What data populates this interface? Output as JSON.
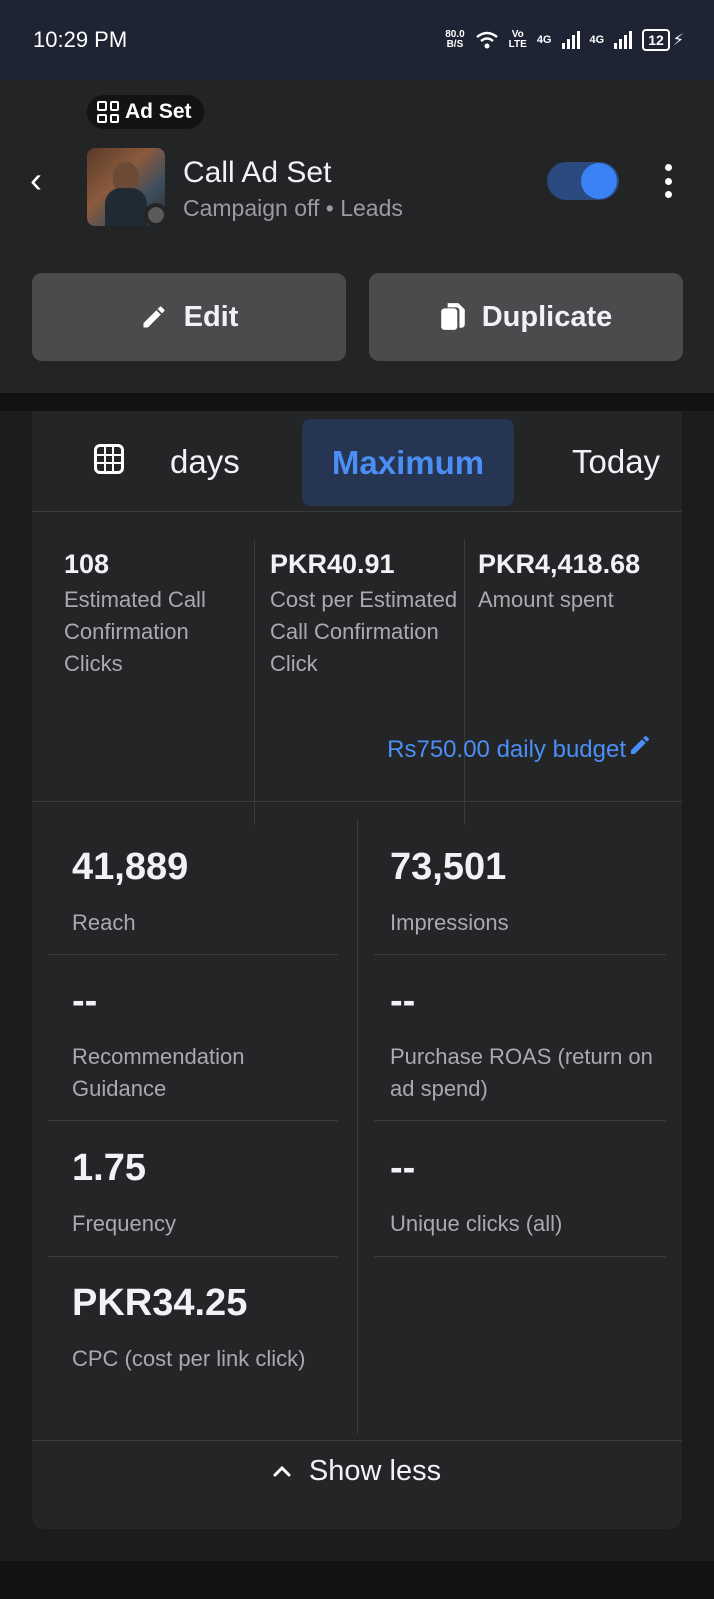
{
  "status_bar": {
    "time": "10:29 PM",
    "net_speed_value": "80.0",
    "net_speed_unit": "B/S",
    "volte_top": "Vo",
    "volte_bottom": "LTE",
    "network1": "4G",
    "network2": "4G",
    "battery": "12"
  },
  "header": {
    "badge_label": "Ad Set",
    "title": "Call Ad Set",
    "subtitle": "Campaign off • Leads",
    "toggle_on": true,
    "edit_label": "Edit",
    "duplicate_label": "Duplicate"
  },
  "date_range": {
    "days_label": "days",
    "selected_label": "Maximum",
    "today_label": "Today"
  },
  "summary": [
    {
      "value": "108",
      "label": "Estimated Call Confirmation Clicks"
    },
    {
      "value": "PKR40.91",
      "label": "Cost per Estimated Call Confirmation Click"
    },
    {
      "value": "PKR4,418.68",
      "label": "Amount spent"
    }
  ],
  "budget_label": "Rs750.00 daily budget",
  "metrics": {
    "reach": {
      "value": "41,889",
      "label": "Reach"
    },
    "impressions": {
      "value": "73,501",
      "label": "Impressions"
    },
    "recommendation": {
      "value": "--",
      "label": "Recommendation Guidance"
    },
    "roas": {
      "value": "--",
      "label": "Purchase ROAS (return on ad spend)"
    },
    "frequency": {
      "value": "1.75",
      "label": "Frequency"
    },
    "unique_clicks": {
      "value": "--",
      "label": "Unique clicks (all)"
    },
    "cpc": {
      "value": "PKR34.25",
      "label": "CPC (cost per link click)"
    }
  },
  "show_less_label": "Show less",
  "colors": {
    "accent": "#4b8ef5",
    "background": "#1c1c1e",
    "card": "#242526"
  }
}
